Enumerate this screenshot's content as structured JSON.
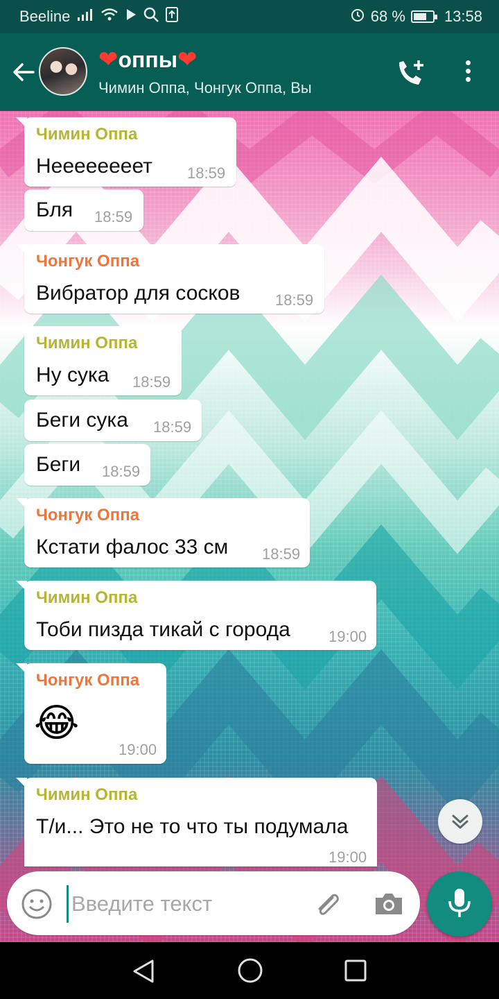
{
  "status_bar": {
    "carrier": "Beeline",
    "battery": "68 %",
    "battery_level": 0.68,
    "time": "13:58"
  },
  "header": {
    "title": "оппы",
    "title_emoji": "❤",
    "participants": "Чимин Оппа, Чонгук Оппа, Вы"
  },
  "messages": [
    {
      "sender": "Чимин Оппа",
      "text": "Неееееееет",
      "time": "18:59"
    },
    {
      "text": "Бля",
      "time": "18:59"
    },
    {
      "sender": "Чонгук Оппа",
      "text": "Вибратор для сосков",
      "time": "18:59"
    },
    {
      "sender": "Чимин Оппа",
      "text": "Ну сука",
      "time": "18:59"
    },
    {
      "text": "Беги сука",
      "time": "18:59"
    },
    {
      "text": "Беги",
      "time": "18:59"
    },
    {
      "sender": "Чонгук Оппа",
      "text": "Кстати фалос 33 см",
      "time": "18:59"
    },
    {
      "sender": "Чимин Оппа",
      "text": "Тоби пизда тикай с города",
      "time": "19:00"
    },
    {
      "sender": "Чонгук Оппа",
      "text": "😂",
      "time": "19:00"
    },
    {
      "sender": "Чимин Оппа",
      "text": "Т/и... Это не то что ты подумала",
      "time": "19:00"
    }
  ],
  "composer": {
    "placeholder": "Введите текст",
    "value": ""
  },
  "colors": {
    "header": "#075e54",
    "status_bar": "#0a4f4a",
    "accent": "#128c7e",
    "sender_jimin": "#b8b530",
    "sender_jungkook": "#f0753a"
  },
  "icons": [
    "back-arrow-icon",
    "add-call-icon",
    "more-vert-icon",
    "emoji-icon",
    "attach-icon",
    "camera-icon",
    "mic-icon",
    "chevron-double-down-icon",
    "nav-back-icon",
    "nav-home-icon",
    "nav-recent-icon"
  ]
}
